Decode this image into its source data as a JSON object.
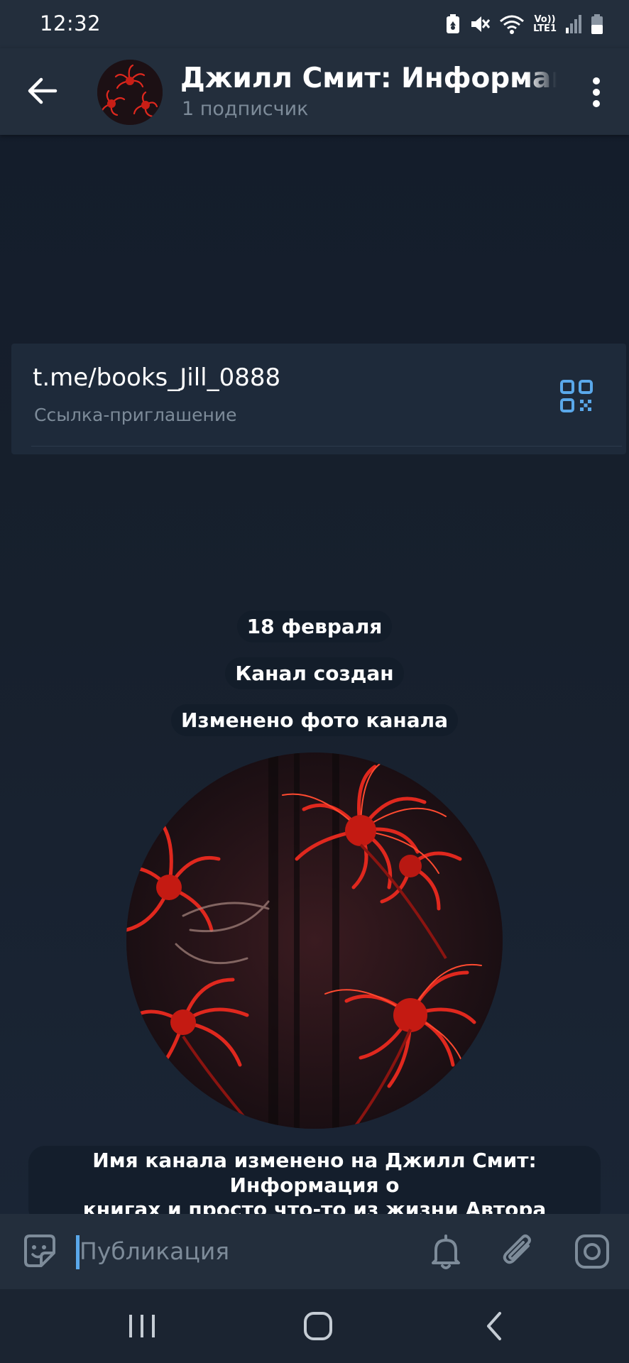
{
  "status_bar": {
    "time": "12:32",
    "network_label_top": "Vo))",
    "network_label_bottom": "LTE1",
    "icons": [
      "battery-saver-icon",
      "mute-icon",
      "wifi-icon",
      "lte-icon",
      "signal-icon",
      "battery-icon"
    ]
  },
  "header": {
    "title": "Джилл Смит: Информация о книгах и просто что-то из жизни Автора",
    "subtitle": "1 подписчик",
    "icons": [
      "back-arrow-icon",
      "more-vertical-icon"
    ]
  },
  "invite": {
    "link": "t.me/books_Jill_0888",
    "label": "Ссылка-приглашение",
    "icon": "qr-code-icon"
  },
  "messages": {
    "date": "18 февраля",
    "created": "Канал создан",
    "photo_changed": "Изменено фото канала",
    "renamed_line1": "Имя канала изменено на Джилл Смит: Информация о",
    "renamed_line2": "книгах и просто что-то из жизни Автора"
  },
  "composer": {
    "placeholder": "Публикация",
    "icons": [
      "sticker-icon",
      "bell-icon",
      "paperclip-icon",
      "camera-icon"
    ]
  },
  "nav": {
    "icons": [
      "recents-icon",
      "home-icon",
      "back-icon"
    ]
  },
  "colors": {
    "header_bg": "#232e3c",
    "chat_bg": "#17202d",
    "accent": "#5aa8ea",
    "muted_text": "#7d8b99",
    "flower_red": "#e0281e"
  }
}
